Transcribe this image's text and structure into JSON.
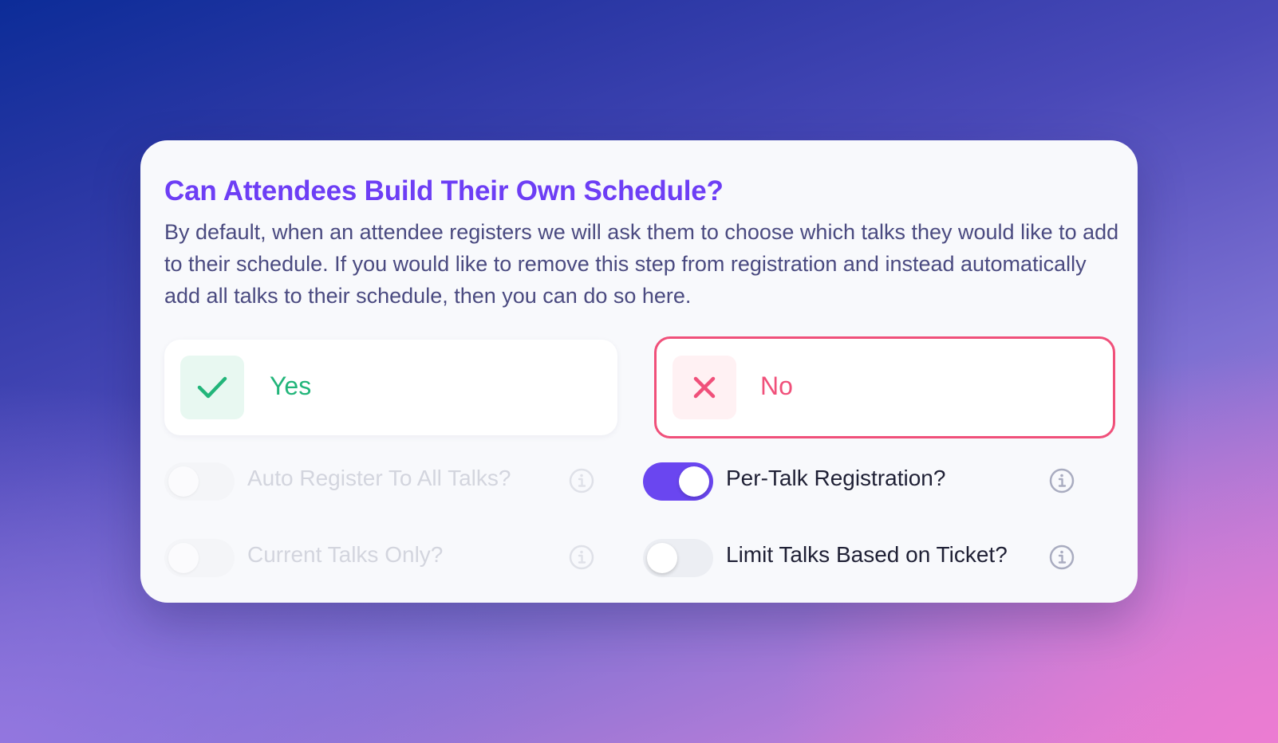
{
  "card": {
    "title": "Can Attendees Build Their Own Schedule?",
    "description": "By default, when an attendee registers we will ask them to choose which talks they would like to add to their schedule. If you would like to remove this step from registration and instead automatically add all talks to their schedule, then you can do so here."
  },
  "options": {
    "yes_label": "Yes",
    "no_label": "No",
    "selected": "No"
  },
  "settings": {
    "auto_register": {
      "label": "Auto Register To All Talks?",
      "enabled": false,
      "disabled": true
    },
    "current_talks": {
      "label": "Current Talks Only?",
      "enabled": false,
      "disabled": true
    },
    "per_talk": {
      "label": "Per-Talk Registration?",
      "enabled": true,
      "disabled": false
    },
    "limit_talks": {
      "label": "Limit Talks Based on Ticket?",
      "enabled": false,
      "disabled": false
    }
  },
  "icons": {
    "yes": "check-icon",
    "no": "close-icon",
    "info": "info-icon"
  },
  "colors": {
    "title": "#6d3ef5",
    "yes": "#22b57a",
    "no": "#f0507a",
    "toggle_on": "#6a46f0"
  }
}
